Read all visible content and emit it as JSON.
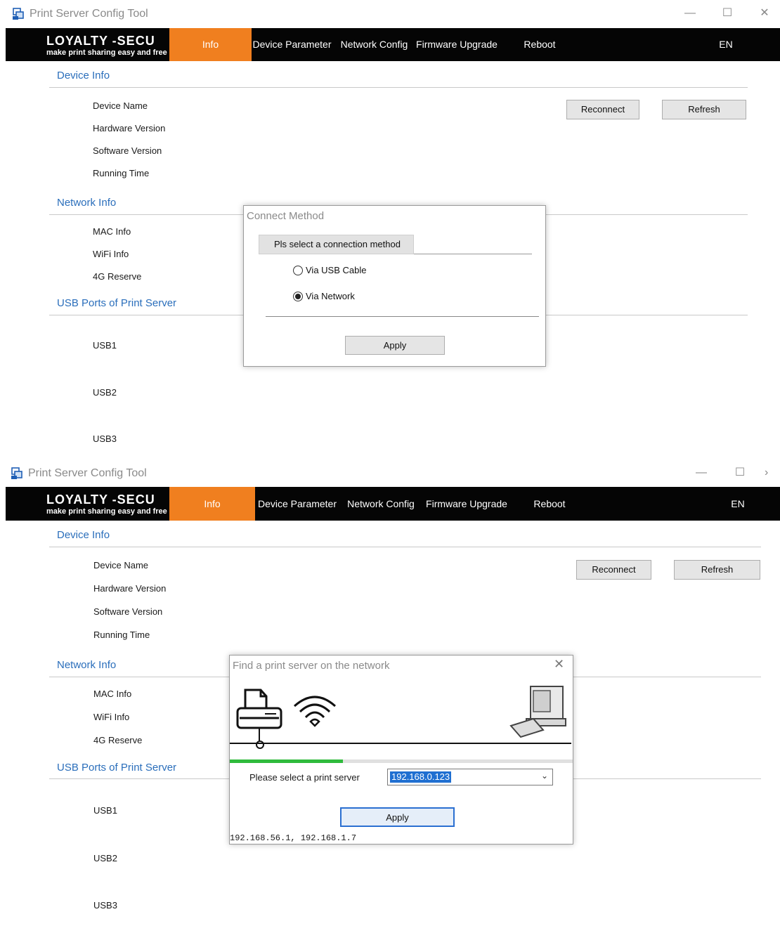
{
  "window1": {
    "title": "Print Server Config Tool",
    "brand": {
      "name": "LOYALTY -SECU",
      "tagline": "make print sharing easy and free"
    },
    "nav": [
      "Info",
      "Device Parameter",
      "Network Config",
      "Firmware Upgrade",
      "Reboot",
      "EN"
    ],
    "sections": {
      "device_info": "Device Info",
      "network_info": "Network Info",
      "usb_ports": "USB Ports of Print Server"
    },
    "device_labels": [
      "Device Name",
      "Hardware Version",
      "Software Version",
      "Running Time"
    ],
    "network_labels": [
      "MAC Info",
      "WiFi Info",
      "4G Reserve"
    ],
    "usb_labels": [
      "USB1",
      "USB2",
      "USB3"
    ],
    "buttons": {
      "reconnect": "Reconnect",
      "refresh": "Refresh"
    },
    "dialog": {
      "title": "Connect Method",
      "tab": "Pls select a connection method",
      "options": [
        "Via USB Cable",
        "Via Network"
      ],
      "selected": "Via Network",
      "apply": "Apply"
    }
  },
  "window2": {
    "title": "Print Server Config Tool",
    "brand": {
      "name": "LOYALTY -SECU",
      "tagline": "make print sharing easy and free"
    },
    "nav": [
      "Info",
      "Device Parameter",
      "Network Config",
      "Firmware Upgrade",
      "Reboot",
      "EN"
    ],
    "sections": {
      "device_info": "Device Info",
      "network_info": "Network Info",
      "usb_ports": "USB Ports of Print Server"
    },
    "device_labels": [
      "Device Name",
      "Hardware Version",
      "Software Version",
      "Running Time"
    ],
    "network_labels": [
      "MAC Info",
      "WiFi Info",
      "4G Reserve"
    ],
    "usb_labels": [
      "USB1",
      "USB2",
      "USB3"
    ],
    "buttons": {
      "reconnect": "Reconnect",
      "refresh": "Refresh"
    },
    "dialog": {
      "title": "Find a print server on the network",
      "select_label": "Please select a print server",
      "selected_server": "192.168.0.123",
      "apply": "Apply",
      "local_ips": "192.168.56.1, 192.168.1.7",
      "progress": 0.33
    }
  },
  "colors": {
    "accent": "#f07f1f",
    "link": "#2a6ebb",
    "navbar": "#050505",
    "progress": "#2fbb3c"
  },
  "icons": [
    "app-icon",
    "minimize-icon",
    "maximize-icon",
    "close-icon",
    "printer-icon",
    "wifi-icon",
    "computer-icon",
    "dialog-close-icon"
  ]
}
